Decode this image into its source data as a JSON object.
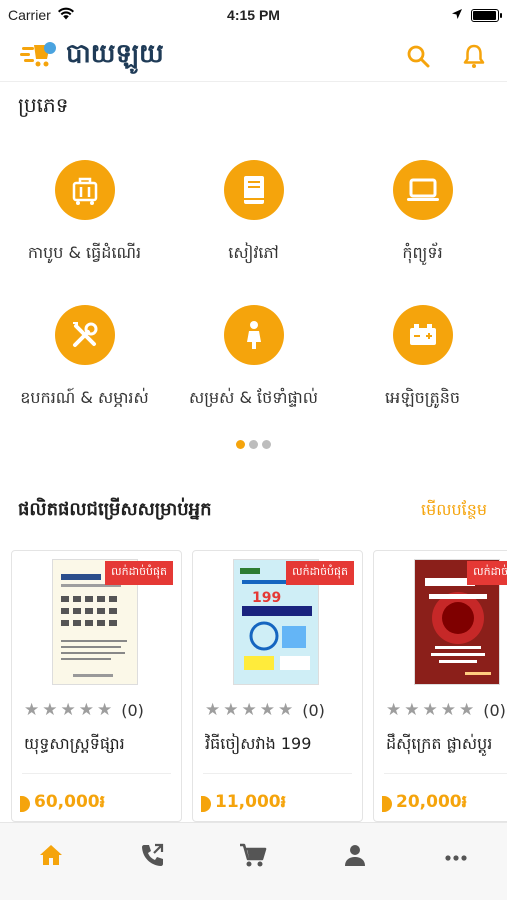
{
  "status_bar": {
    "carrier": "Carrier",
    "time": "4:15 PM"
  },
  "header": {
    "app_name": "បាយឡូយ"
  },
  "categories": {
    "title": "ប្រភេទ",
    "items": [
      {
        "label": "កាបូប & ធ្វើដំណើរ",
        "icon": "luggage-icon"
      },
      {
        "label": "សៀវភៅ",
        "icon": "book-icon"
      },
      {
        "label": "កុំព្យូទ័រ",
        "icon": "laptop-icon"
      },
      {
        "label": "ឧបករណ៍ & សម្ភារស់",
        "icon": "tools-icon"
      },
      {
        "label": "សម្រស់ & ថែទាំផ្ទាល់",
        "icon": "beauty-icon"
      },
      {
        "label": "អេឡិចត្រូនិច",
        "icon": "battery-icon"
      }
    ],
    "pager": {
      "pages": 3,
      "active": 0
    }
  },
  "products": {
    "title": "ផលិតផលជម្រើសសម្រាប់អ្នក",
    "see_more": "មើលបន្ថែម",
    "items": [
      {
        "badge": "លក់ដាច់បំផុត",
        "rating_count": "(0)",
        "name": "យុទ្ធសាស្រ្តទីផ្សារ",
        "price": "60,000៛",
        "cover_color": "#fbf8e8"
      },
      {
        "badge": "លក់ដាច់បំផុត",
        "rating_count": "(0)",
        "name": "វិធីចៀសវាង 199",
        "price": "11,000៛",
        "cover_color": "#cfeef6"
      },
      {
        "badge": "លក់ដាច់បំផុត",
        "rating_count": "(0)",
        "name": "ដឹស៊ីក្រេត ផ្លាស់ប្ដូរ",
        "price": "20,000៛",
        "cover_color": "#8b1f1a"
      }
    ]
  },
  "tabs": [
    {
      "name": "home",
      "icon": "home-icon",
      "active": true
    },
    {
      "name": "contact",
      "icon": "phone-icon",
      "active": false
    },
    {
      "name": "cart",
      "icon": "cart-icon",
      "active": false
    },
    {
      "name": "profile",
      "icon": "person-icon",
      "active": false
    },
    {
      "name": "more",
      "icon": "more-icon",
      "active": false
    }
  ],
  "colors": {
    "accent": "#f5a40c",
    "badge": "#e53935",
    "brand_text": "#1f3b57",
    "tab_inactive": "#555555"
  }
}
